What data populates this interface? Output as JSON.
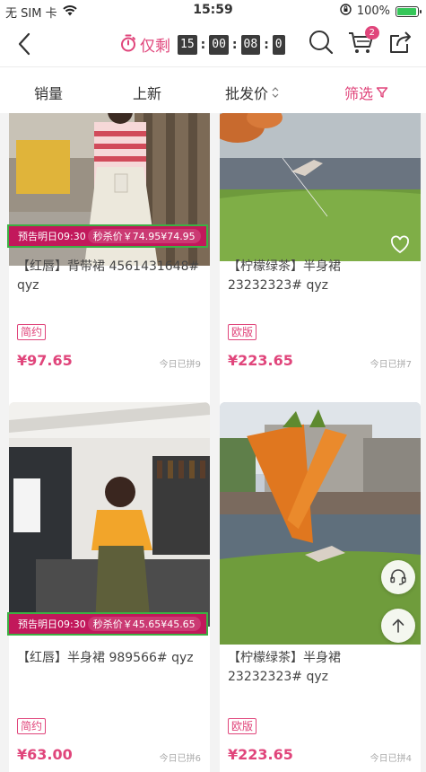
{
  "status_bar": {
    "carrier": "无 SIM 卡",
    "time": "15:59",
    "battery_text": "100%",
    "battery_level": 1.0
  },
  "nav": {
    "timer_label": "仅剩",
    "timer_digits": [
      "15",
      "00",
      "08",
      "0"
    ],
    "cart_badge": "2"
  },
  "filters": {
    "sales": "销量",
    "new": "上新",
    "wholesale_price": "批发价",
    "screen": "筛选"
  },
  "products": [
    {
      "title": "【红唇】背带裙  4561431648# qyz",
      "tag": "简约",
      "price": "¥97.65",
      "sold": "今日已拼9",
      "banner_left": "预告明日09:30",
      "banner_right": "秒杀价￥74.95¥74.95"
    },
    {
      "title": "【柠檬绿茶】半身裙 23232323#  qyz",
      "tag": "欧版",
      "price": "¥223.65",
      "sold": "今日已拼7"
    },
    {
      "title": "【红唇】半身裙  989566#  qyz",
      "tag": "简约",
      "price": "¥63.00",
      "sold": "今日已拼6",
      "banner_left": "预告明日09:30",
      "banner_right": "秒杀价￥45.65¥45.65"
    },
    {
      "title": "【柠檬绿茶】半身裙 23232323#  qyz",
      "tag": "欧版",
      "price": "¥223.65",
      "sold": "今日已拼4"
    }
  ]
}
